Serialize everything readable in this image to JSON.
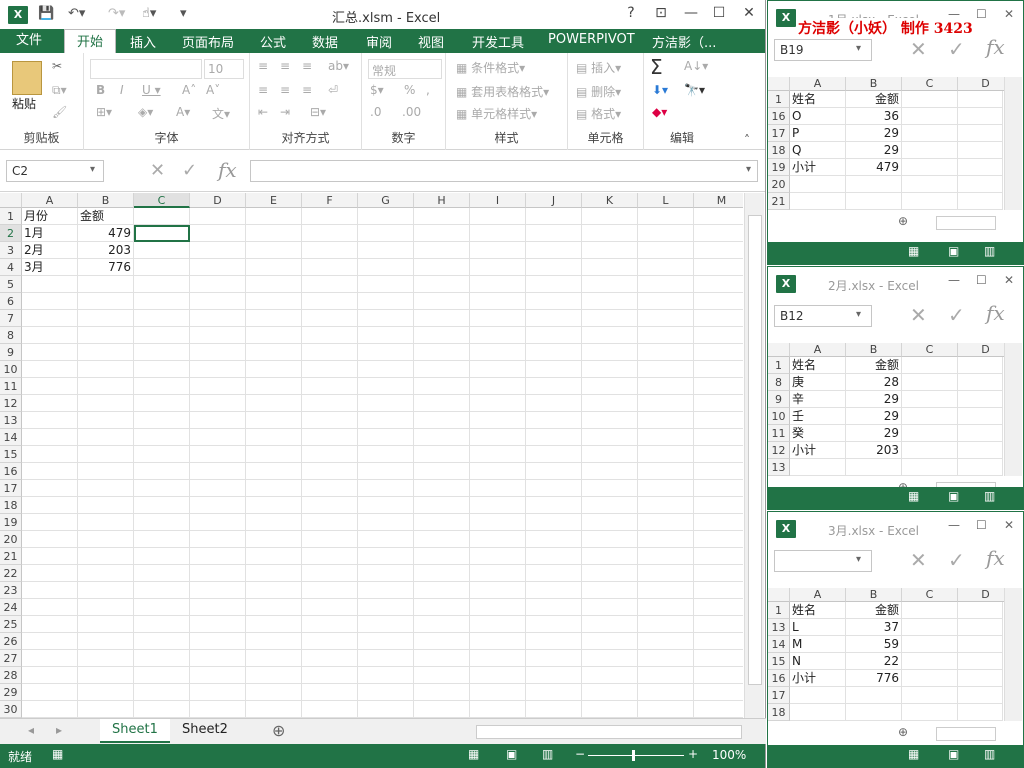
{
  "main": {
    "title": "汇总.xlsm - Excel",
    "tabs": [
      "文件",
      "开始",
      "插入",
      "页面布局",
      "公式",
      "数据",
      "审阅",
      "视图",
      "开发工具",
      "POWERPIVOT",
      "方洁影（..."
    ],
    "ribbon": {
      "clipboard": {
        "paste": "粘贴",
        "label": "剪贴板"
      },
      "font": {
        "size": "10",
        "label": "字体"
      },
      "align": {
        "label": "对齐方式"
      },
      "number": {
        "format": "常规",
        "label": "数字"
      },
      "styles": {
        "cond": "条件格式",
        "table": "套用表格格式",
        "cell": "单元格样式",
        "label": "样式"
      },
      "cells": {
        "insert": "插入",
        "delete": "删除",
        "format": "格式",
        "label": "单元格"
      },
      "edit": {
        "label": "编辑"
      }
    },
    "namebox": "C2",
    "fx": "fx",
    "columns": [
      "A",
      "B",
      "C",
      "D",
      "E",
      "F",
      "G",
      "H",
      "I",
      "J",
      "K",
      "L",
      "M"
    ],
    "rows_count": 30,
    "cells": [
      {
        "r": 1,
        "c": "A",
        "v": "月份"
      },
      {
        "r": 1,
        "c": "B",
        "v": "金额"
      },
      {
        "r": 2,
        "c": "A",
        "v": "1月"
      },
      {
        "r": 2,
        "c": "B",
        "v": "479",
        "num": true
      },
      {
        "r": 3,
        "c": "A",
        "v": "2月"
      },
      {
        "r": 3,
        "c": "B",
        "v": "203",
        "num": true
      },
      {
        "r": 4,
        "c": "A",
        "v": "3月"
      },
      {
        "r": 4,
        "c": "B",
        "v": "776",
        "num": true
      }
    ],
    "sheets": [
      "Sheet1",
      "Sheet2"
    ],
    "status": "就绪",
    "zoom": "100%"
  },
  "overlay_title": "方洁影（小妖） 制作 3423",
  "side_windows": [
    {
      "title": "1月.xlsx - Excel",
      "namebox": "B19",
      "rows": [
        {
          "n": "1",
          "a": "姓名",
          "b": "金额"
        },
        {
          "n": "16",
          "a": "O",
          "b": "36"
        },
        {
          "n": "17",
          "a": "P",
          "b": "29"
        },
        {
          "n": "18",
          "a": "Q",
          "b": "29"
        },
        {
          "n": "19",
          "a": "小计",
          "b": "479"
        },
        {
          "n": "20",
          "a": "",
          "b": ""
        },
        {
          "n": "21",
          "a": "",
          "b": ""
        }
      ]
    },
    {
      "title": "2月.xlsx - Excel",
      "namebox": "B12",
      "rows": [
        {
          "n": "1",
          "a": "姓名",
          "b": "金额"
        },
        {
          "n": "8",
          "a": "庚",
          "b": "28"
        },
        {
          "n": "9",
          "a": "辛",
          "b": "29"
        },
        {
          "n": "10",
          "a": "壬",
          "b": "29"
        },
        {
          "n": "11",
          "a": "癸",
          "b": "29"
        },
        {
          "n": "12",
          "a": "小计",
          "b": "203"
        },
        {
          "n": "13",
          "a": "",
          "b": ""
        }
      ]
    },
    {
      "title": "3月.xlsx - Excel",
      "namebox": "",
      "rows": [
        {
          "n": "1",
          "a": "姓名",
          "b": "金额"
        },
        {
          "n": "13",
          "a": "L",
          "b": "37"
        },
        {
          "n": "14",
          "a": "M",
          "b": "59"
        },
        {
          "n": "15",
          "a": "N",
          "b": "22"
        },
        {
          "n": "16",
          "a": "小计",
          "b": "776"
        },
        {
          "n": "17",
          "a": "",
          "b": ""
        },
        {
          "n": "18",
          "a": "",
          "b": ""
        }
      ]
    }
  ],
  "side_cols": [
    "A",
    "B",
    "C",
    "D"
  ]
}
